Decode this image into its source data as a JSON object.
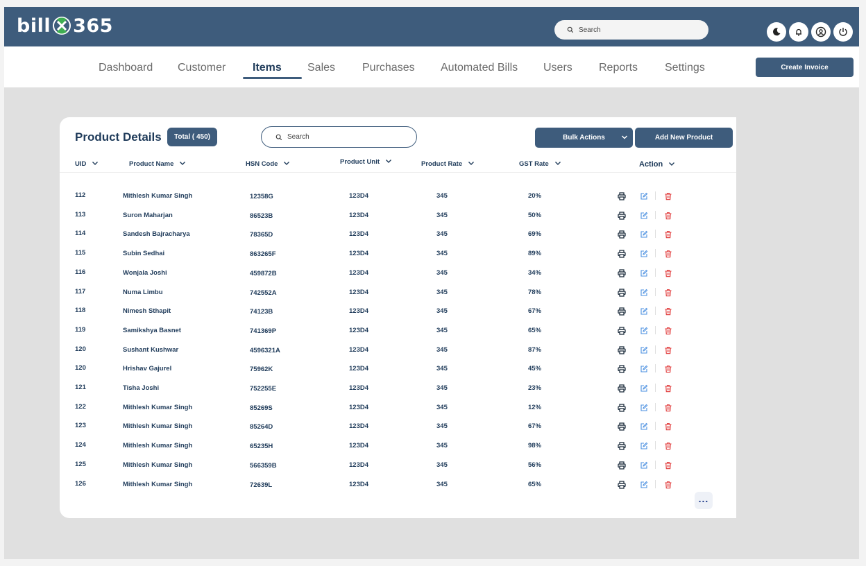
{
  "app": {
    "logo_left": "bill",
    "logo_right": "365"
  },
  "header": {
    "search_placeholder": "Search"
  },
  "nav": {
    "items": [
      "Dashboard",
      "Customer",
      "Items",
      "Sales",
      "Purchases",
      "Automated Bills",
      "Users",
      "Reports",
      "Settings"
    ],
    "active": "Items",
    "create_invoice": "Create Invoice"
  },
  "card": {
    "title": "Product Details",
    "total_badge": "Total  ( 450)",
    "search_placeholder": "Search",
    "bulk_actions": "Bulk Actions",
    "add_new_product": "Add New Product"
  },
  "table": {
    "columns": [
      "UID",
      "Product Name",
      "HSN Code",
      "Product Unit",
      "Product Rate",
      "GST Rate",
      "Action"
    ],
    "rows": [
      [
        "112",
        "Mithlesh Kumar Singh",
        "12358G",
        "123D4",
        "345",
        "20%"
      ],
      [
        "113",
        "Suron Maharjan",
        "86523B",
        "123D4",
        "345",
        "50%"
      ],
      [
        "114",
        "Sandesh Bajracharya",
        "78365D",
        "123D4",
        "345",
        "69%"
      ],
      [
        "115",
        "Subin Sedhai",
        "863265F",
        "123D4",
        "345",
        "89%"
      ],
      [
        "116",
        "Wonjala Joshi",
        "459872B",
        "123D4",
        "345",
        "34%"
      ],
      [
        "117",
        "Numa Limbu",
        "742552A",
        "123D4",
        "345",
        "78%"
      ],
      [
        "118",
        "Nimesh Sthapit",
        "74123B",
        "123D4",
        "345",
        "67%"
      ],
      [
        "119",
        "Samikshya Basnet",
        "741369P",
        "123D4",
        "345",
        "65%"
      ],
      [
        "120",
        "Sushant Kushwar",
        "4596321A",
        "123D4",
        "345",
        "87%"
      ],
      [
        "120",
        "Hrishav Gajurel",
        "75962K",
        "123D4",
        "345",
        "45%"
      ],
      [
        "121",
        "Tisha Joshi",
        "752255E",
        "123D4",
        "345",
        "23%"
      ],
      [
        "122",
        "Mithlesh Kumar Singh",
        "85269S",
        "123D4",
        "345",
        "12%"
      ],
      [
        "123",
        "Mithlesh Kumar Singh",
        "85264D",
        "123D4",
        "345",
        "67%"
      ],
      [
        "124",
        "Mithlesh Kumar Singh",
        "65235H",
        "123D4",
        "345",
        "98%"
      ],
      [
        "125",
        "Mithlesh Kumar Singh",
        "566359B",
        "123D4",
        "345",
        "56%"
      ],
      [
        "126",
        "Mithlesh Kumar Singh",
        "72639L",
        "123D4",
        "345",
        "65%"
      ]
    ],
    "more_label": "..."
  },
  "colors": {
    "brand": "#3e5c7c",
    "text": "#1f3b5a",
    "edit": "#4a8fe0",
    "delete": "#e34848"
  }
}
